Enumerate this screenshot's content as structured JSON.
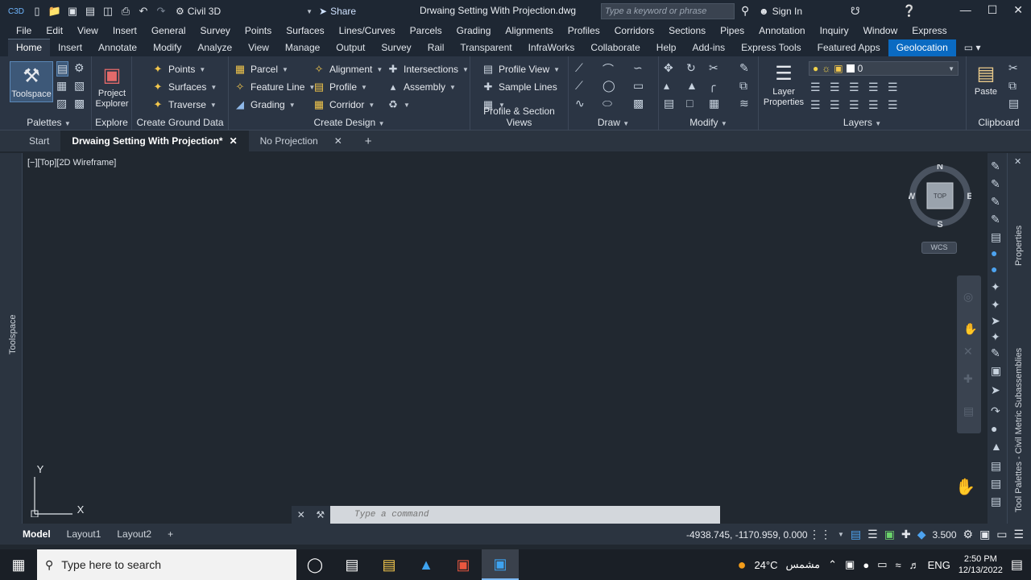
{
  "app": {
    "badge": "C3D",
    "workspace": "Civil 3D",
    "share": "Share",
    "doc_title": "Drwaing Setting With Projection.dwg",
    "search_placeholder": "Type a keyword or phrase",
    "sign_in": "Sign In"
  },
  "menu": [
    "File",
    "Edit",
    "View",
    "Insert",
    "General",
    "Survey",
    "Points",
    "Surfaces",
    "Lines/Curves",
    "Parcels",
    "Grading",
    "Alignments",
    "Profiles",
    "Corridors",
    "Sections",
    "Pipes",
    "Annotation",
    "Inquiry",
    "Window",
    "Express"
  ],
  "ribbon_tabs": [
    "Home",
    "Insert",
    "Annotate",
    "Modify",
    "Analyze",
    "View",
    "Manage",
    "Output",
    "Survey",
    "Rail",
    "Transparent",
    "InfraWorks",
    "Collaborate",
    "Help",
    "Add-ins",
    "Express Tools",
    "Featured Apps",
    "Geolocation"
  ],
  "ribbon": {
    "palettes": {
      "toolspace": "Toolspace",
      "title": "Palettes"
    },
    "explore": {
      "project_explorer_1": "Project",
      "project_explorer_2": "Explorer",
      "title": "Explore"
    },
    "ground": {
      "points": "Points",
      "surfaces": "Surfaces",
      "traverse": "Traverse",
      "title": "Create Ground Data"
    },
    "design": {
      "parcel": "Parcel",
      "feature_line": "Feature Line",
      "grading": "Grading",
      "alignment": "Alignment",
      "profile": "Profile",
      "corridor": "Corridor",
      "intersections": "Intersections",
      "assembly": "Assembly",
      "title": "Create Design"
    },
    "profile_views": {
      "profile_view": "Profile View",
      "sample_lines": "Sample Lines",
      "title": "Profile & Section Views"
    },
    "draw": {
      "title": "Draw"
    },
    "modify": {
      "title": "Modify"
    },
    "layers": {
      "layer_props_1": "Layer",
      "layer_props_2": "Properties",
      "current_layer": "0",
      "title": "Layers"
    },
    "clipboard": {
      "paste": "Paste",
      "title": "Clipboard"
    }
  },
  "doc_tabs": [
    "Start",
    "Drwaing Setting With Projection*",
    "No Projection"
  ],
  "viewport_label": "[−][Top][2D Wireframe]",
  "compass": {
    "n": "N",
    "s": "S",
    "e": "E",
    "w": "W",
    "top": "TOP",
    "wcs": "WCS"
  },
  "left_palette": "Toolspace",
  "right_palette_top": "Properties",
  "right_palette_bottom": "Tool Palettes - Civil Metric Subassemblies",
  "ucs": {
    "y": "Y",
    "x": "X"
  },
  "command_placeholder": "Type a command",
  "layout_tabs": [
    "Model",
    "Layout1",
    "Layout2"
  ],
  "status": {
    "coords": "-4938.745, -1170.959, 0.000",
    "scale": "3.500"
  },
  "taskbar": {
    "search_placeholder": "Type here to search",
    "weather_temp": "24°C",
    "weather_text": "مشمس",
    "lang": "ENG",
    "time": "2:50 PM",
    "date": "12/13/2022"
  },
  "colors": {
    "accent": "#0a6ac2",
    "ribbon_bg": "#2b3544",
    "canvas": "#212830"
  }
}
